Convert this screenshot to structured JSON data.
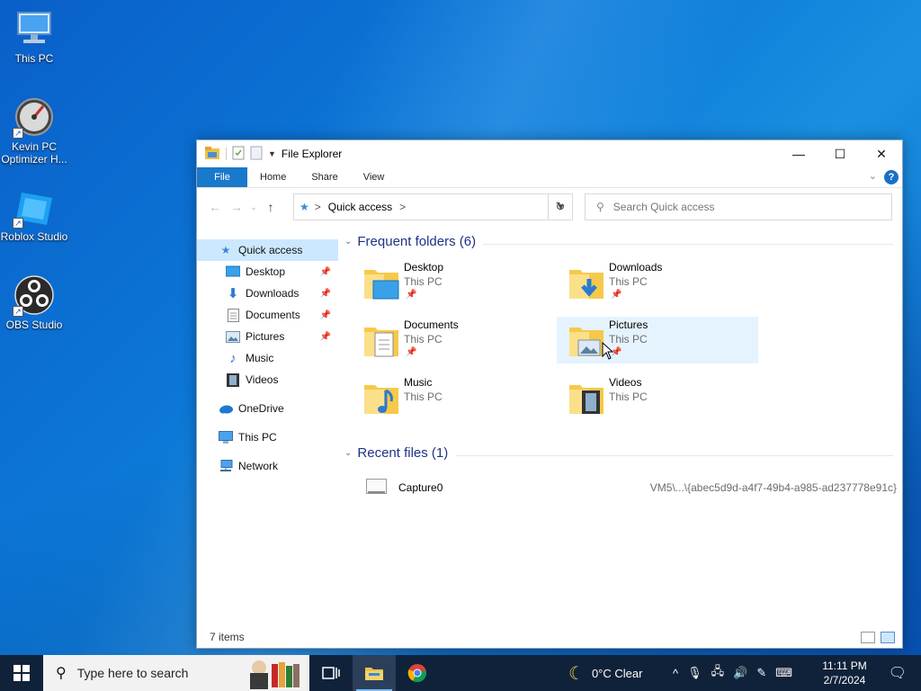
{
  "desktop": {
    "icons": [
      {
        "label": "This PC",
        "icon": "monitor-icon"
      },
      {
        "label": "Kevin PC Optimizer H...",
        "label_line1": "Kevin PC",
        "label_line2": "Optimizer H...",
        "icon": "speedometer-icon"
      },
      {
        "label": "Roblox Studio",
        "icon": "roblox-studio-icon"
      },
      {
        "label": "OBS Studio",
        "icon": "obs-icon"
      }
    ]
  },
  "window": {
    "title": "File Explorer",
    "ribbon_tabs": [
      "File",
      "Home",
      "Share",
      "View"
    ],
    "help_label": "?",
    "address": {
      "crumb": "Quick access",
      "separator": ">"
    },
    "search_placeholder": "Search Quick access",
    "nav_pane": {
      "quick_access": "Quick access",
      "pinned": [
        "Desktop",
        "Downloads",
        "Documents",
        "Pictures"
      ],
      "unpinned": [
        "Music",
        "Videos"
      ],
      "onedrive": "OneDrive",
      "this_pc": "This PC",
      "network": "Network"
    },
    "frequent": {
      "header": "Frequent folders (6)",
      "folders": [
        {
          "name": "Desktop",
          "location": "This PC",
          "pinned": true
        },
        {
          "name": "Downloads",
          "location": "This PC",
          "pinned": true
        },
        {
          "name": "Documents",
          "location": "This PC",
          "pinned": true
        },
        {
          "name": "Pictures",
          "location": "This PC",
          "pinned": true,
          "highlighted": true
        },
        {
          "name": "Music",
          "location": "This PC",
          "pinned": false
        },
        {
          "name": "Videos",
          "location": "This PC",
          "pinned": false
        }
      ]
    },
    "recent": {
      "header": "Recent files (1)",
      "files": [
        {
          "name": "Capture0",
          "path": "VM5\\...\\{abec5d9d-a4f7-49b4-a985-ad237778e91c}"
        }
      ]
    },
    "status": "7 items"
  },
  "taskbar": {
    "search_placeholder": "Type here to search",
    "weather": "0°C  Clear",
    "time": "11:11 PM",
    "date": "2/7/2024"
  },
  "colors": {
    "accent": "#1979ca",
    "group_header": "#1e3287",
    "selection": "#cce8ff",
    "taskbar": "#10223a"
  }
}
